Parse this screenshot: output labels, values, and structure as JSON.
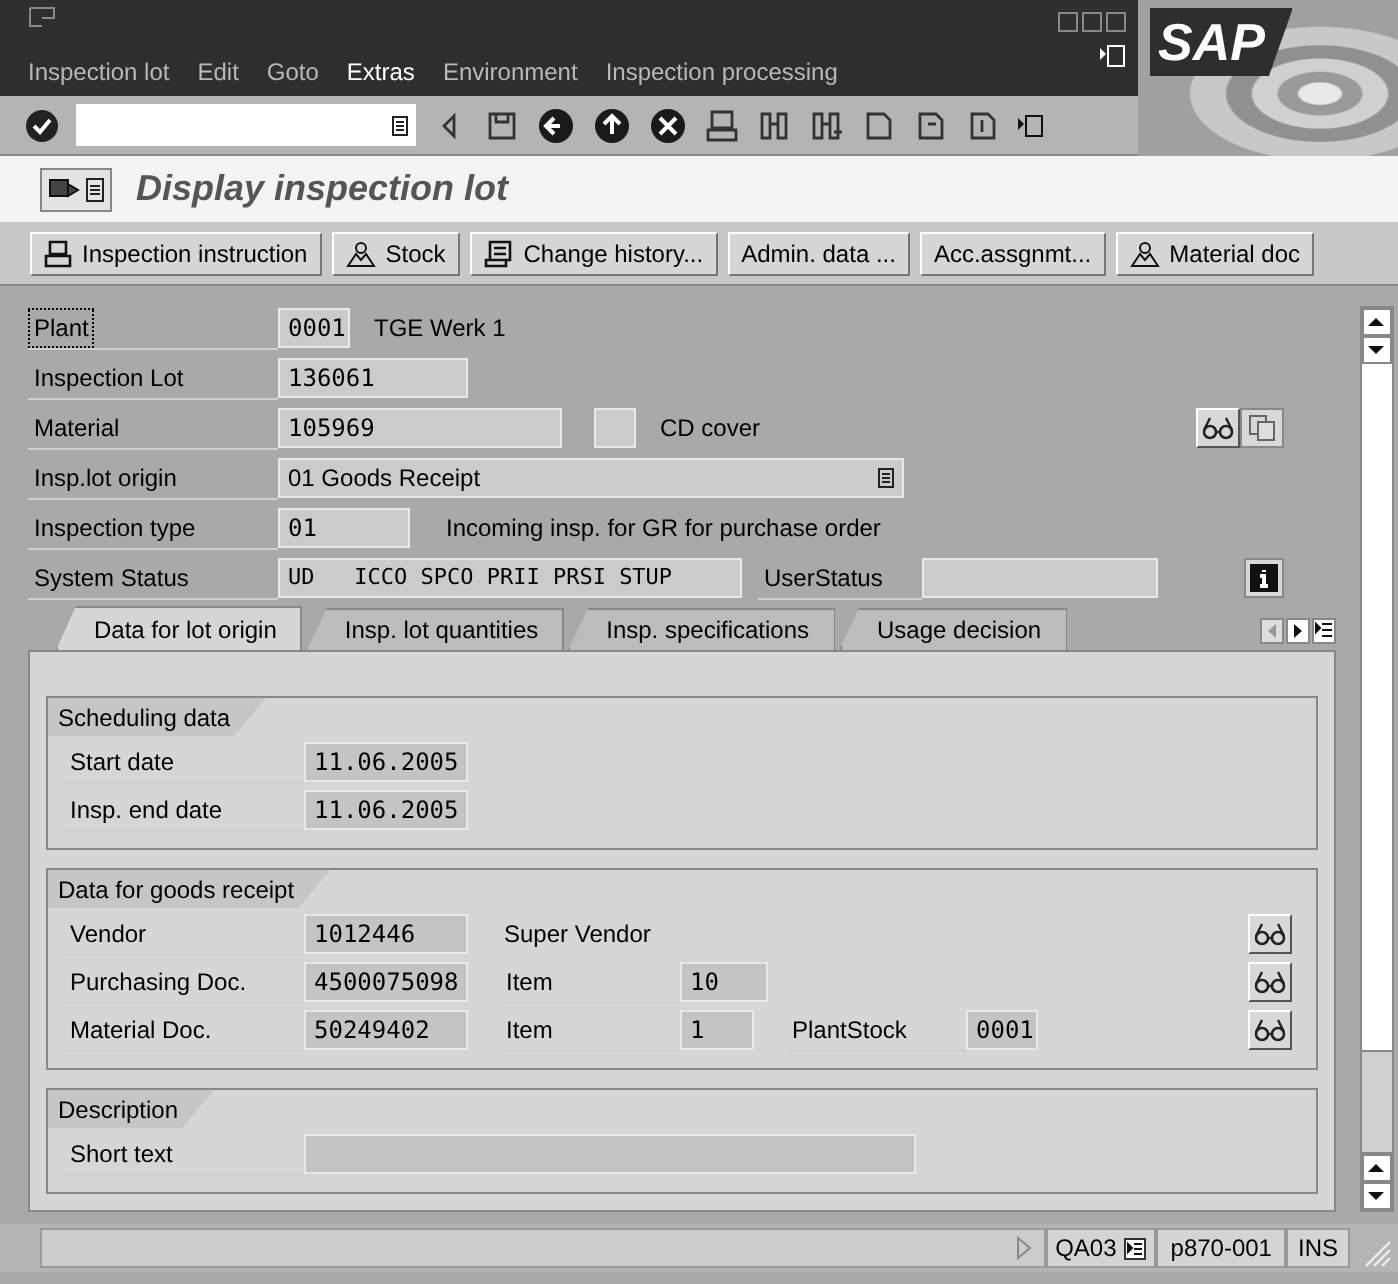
{
  "menu": [
    {
      "label": "Inspection lot",
      "selected": false
    },
    {
      "label": "Edit",
      "selected": false
    },
    {
      "label": "Goto",
      "selected": false
    },
    {
      "label": "Extras",
      "selected": true
    },
    {
      "label": "Environment",
      "selected": false
    },
    {
      "label": "Inspection processing",
      "selected": false
    }
  ],
  "logo": "SAP",
  "title": "Display inspection lot",
  "app_toolbar": [
    "Inspection instruction",
    "Stock",
    "Change history...",
    "Admin. data ...",
    "Acc.assgnmt...",
    "Material doc"
  ],
  "header": {
    "plant": {
      "label": "Plant",
      "value": "0001",
      "description": "TGE Werk 1",
      "focused": true
    },
    "inspection_lot": {
      "label": "Inspection Lot",
      "value": "136061"
    },
    "material": {
      "label": "Material",
      "value": "105969",
      "description": "CD cover"
    },
    "lot_origin": {
      "label": "Insp.lot origin",
      "value": "01 Goods Receipt"
    },
    "inspection_type": {
      "label": "Inspection type",
      "value": "01",
      "description": "Incoming insp. for GR for purchase order"
    },
    "system_status": {
      "label": "System Status",
      "value": "UD   ICCO SPCO PRII PRSI STUP",
      "user_status_label": "UserStatus"
    }
  },
  "tabs": [
    {
      "label": "Data for lot origin",
      "selected": true
    },
    {
      "label": "Insp. lot quantities",
      "selected": false
    },
    {
      "label": "Insp. specifications",
      "selected": false
    },
    {
      "label": "Usage decision",
      "selected": false
    }
  ],
  "scheduling": {
    "title": "Scheduling data",
    "rows": [
      {
        "label": "Start date",
        "value": "11.06.2005"
      },
      {
        "label": "Insp. end date",
        "value": "11.06.2005"
      }
    ]
  },
  "goods_receipt": {
    "title": "Data for goods receipt",
    "vendor": {
      "label": "Vendor",
      "value": "1012446",
      "name": "Super Vendor"
    },
    "purchasing_doc": {
      "label": "Purchasing Doc.",
      "value": "4500075098",
      "item_label": "Item",
      "item": "10"
    },
    "material_doc": {
      "label": "Material Doc.",
      "value": "50249402",
      "item_label": "Item",
      "item": "1",
      "plant_stock_label": "PlantStock",
      "plant_stock": "0001"
    }
  },
  "description": {
    "title": "Description",
    "short_text_label": "Short text"
  },
  "status_bar": {
    "transaction": "QA03",
    "system": "p870-001",
    "mode": "INS"
  }
}
